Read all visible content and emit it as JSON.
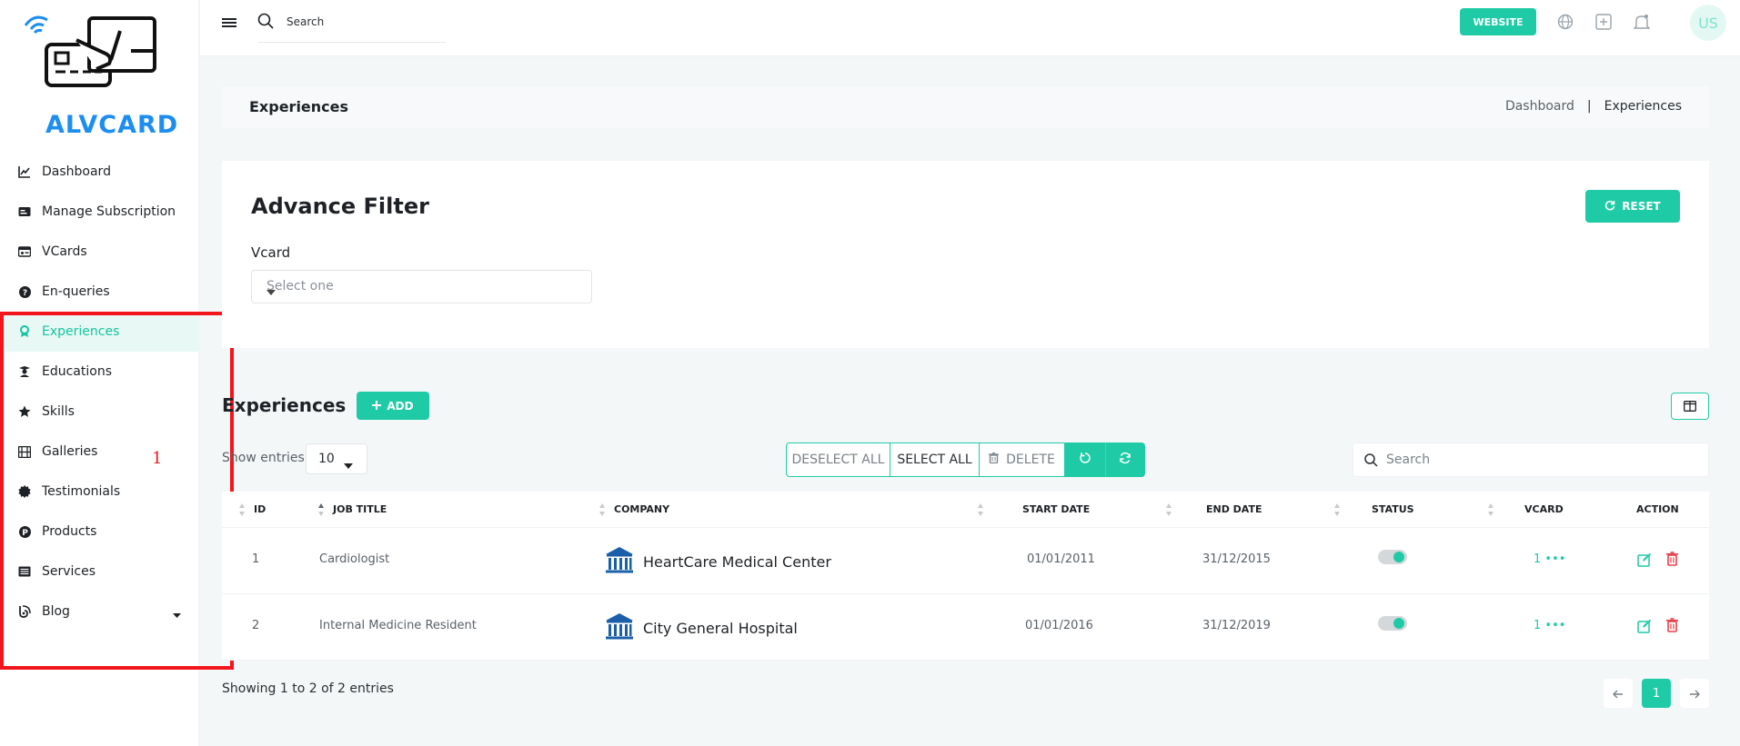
{
  "app": {
    "logo_text": "ALVCARD"
  },
  "sidebar": {
    "items": [
      {
        "label": "Dashboard",
        "icon": "chart-line-icon"
      },
      {
        "label": "Manage Subscription",
        "icon": "card-icon"
      },
      {
        "label": "VCards",
        "icon": "id-card-icon"
      },
      {
        "label": "En-queries",
        "icon": "question-circle-icon"
      },
      {
        "label": "Experiences",
        "icon": "award-icon",
        "active": true
      },
      {
        "label": "Educations",
        "icon": "graduate-icon"
      },
      {
        "label": "Skills",
        "icon": "star-icon"
      },
      {
        "label": "Galleries",
        "icon": "film-icon"
      },
      {
        "label": "Testimonials",
        "icon": "badge-icon"
      },
      {
        "label": "Products",
        "icon": "product-circle-icon"
      },
      {
        "label": "Services",
        "icon": "list-icon"
      },
      {
        "label": "Blog",
        "icon": "blog-icon"
      }
    ]
  },
  "annotation": {
    "label": "1",
    "color": "#f2161c"
  },
  "topbar": {
    "search_placeholder": "Search",
    "website_label": "WEBSITE",
    "avatar_initials": "US"
  },
  "page": {
    "title": "Experiences",
    "breadcrumb": [
      "Dashboard",
      "|",
      "Experiences"
    ]
  },
  "filter": {
    "title": "Advance Filter",
    "reset_label": "RESET",
    "vcard_label": "Vcard",
    "vcard_placeholder": "Select one"
  },
  "table_section": {
    "title": "Experiences",
    "add_label": "ADD",
    "show_entries_label": "Show entries",
    "entries_value": "10",
    "deselect_all_label": "DESELECT ALL",
    "select_all_label": "SELECT ALL",
    "delete_label": "DELETE",
    "search_placeholder": "Search",
    "columns": [
      "ID",
      "JOB TITLE",
      "COMPANY",
      "START DATE",
      "END DATE",
      "STATUS",
      "VCARD",
      "ACTION"
    ],
    "rows": [
      {
        "id": "1",
        "job_title": "Cardiologist",
        "company": "HeartCare Medical Center",
        "start_date": "01/01/2011",
        "end_date": "31/12/2015",
        "status_on": true,
        "vcard": "1 •••"
      },
      {
        "id": "2",
        "job_title": "Internal Medicine Resident",
        "company": "City General Hospital",
        "start_date": "01/01/2016",
        "end_date": "31/12/2019",
        "status_on": true,
        "vcard": "1 •••"
      }
    ],
    "footer_info": "Showing 1 to 2 of 2 entries",
    "current_page": "1"
  },
  "colors": {
    "accent": "#1fcba6",
    "logo_blue": "#1d8ef0",
    "delete_red": "#e8404a"
  }
}
